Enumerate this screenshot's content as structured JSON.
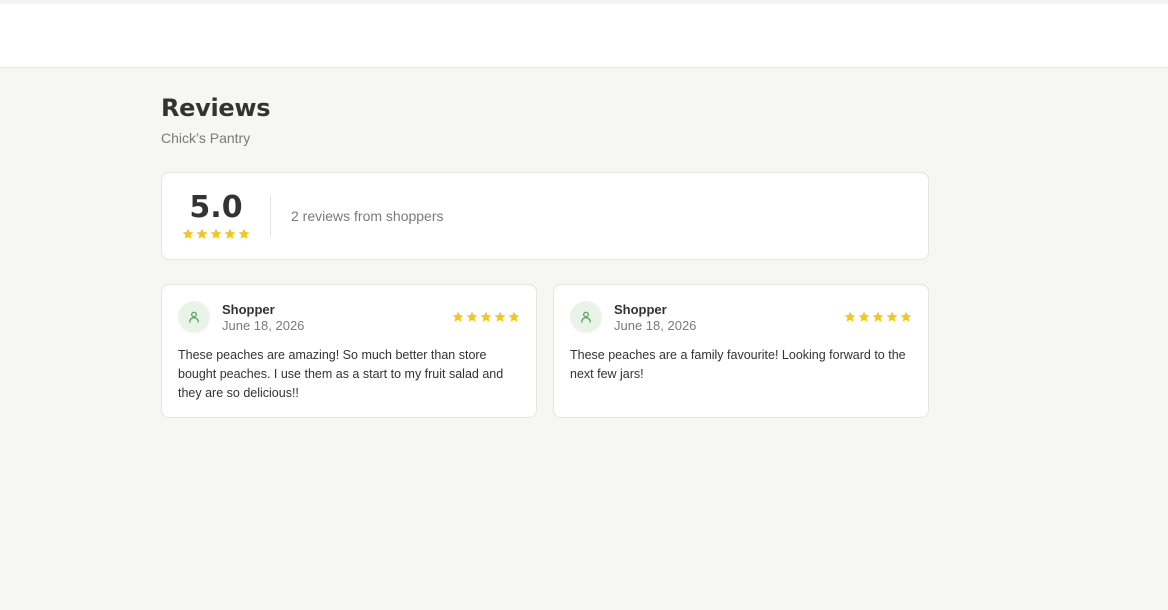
{
  "page": {
    "title": "Reviews",
    "subtitle": "Chick’s Pantry"
  },
  "summary": {
    "average": "5.0",
    "average_stars": 5,
    "text": "2 reviews from shoppers"
  },
  "reviews": [
    {
      "author": "Shopper",
      "date": "June 18, 2026",
      "rating": 5,
      "text": "These peaches are amazing! So much better than store bought peaches. I use them as a start to my fruit salad and they are so delicious!!"
    },
    {
      "author": "Shopper",
      "date": "June 18, 2026",
      "rating": 5,
      "text": "These peaches are a family favourite! Looking forward to the next few jars!"
    }
  ],
  "colors": {
    "star": "#f5c518",
    "avatar_bg": "#eaf3e8",
    "avatar_icon": "#4e9a52"
  },
  "icons": {
    "star": "star-icon",
    "avatar": "user-icon"
  }
}
